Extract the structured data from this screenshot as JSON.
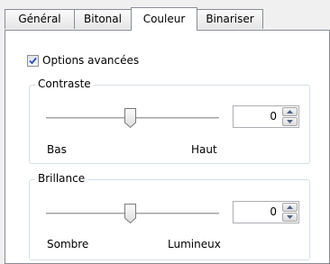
{
  "tabs": [
    {
      "label": "Général",
      "active": false
    },
    {
      "label": "Bitonal",
      "active": false
    },
    {
      "label": "Couleur",
      "active": true
    },
    {
      "label": "Binariser",
      "active": false
    }
  ],
  "advanced_options": {
    "label": "Options avancées",
    "checked": true
  },
  "contrast": {
    "legend": "Contraste",
    "value": "0",
    "min_label": "Bas",
    "max_label": "Haut",
    "slider_position": 0.5
  },
  "brightness": {
    "legend": "Brillance",
    "value": "0",
    "min_label": "Sombre",
    "max_label": "Lumineux",
    "slider_position": 0.5
  }
}
